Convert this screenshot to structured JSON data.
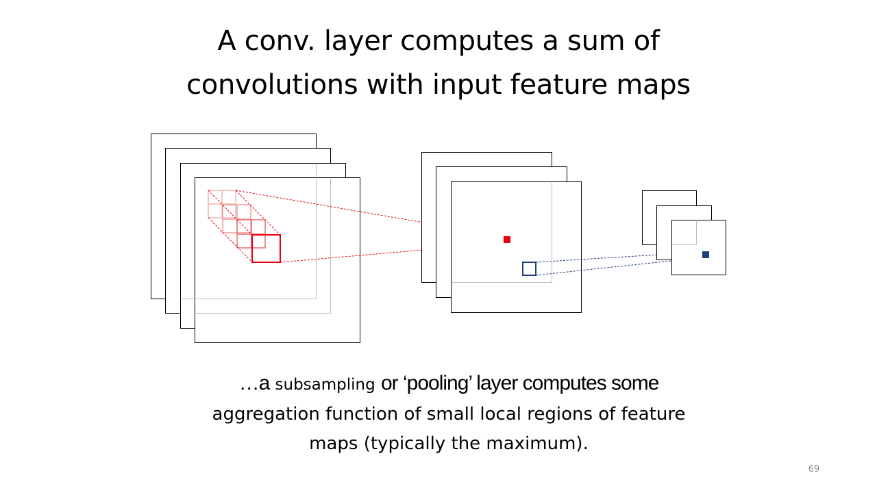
{
  "slide": {
    "title_line1": "A conv. layer computes a sum of",
    "title_line2": "convolutions with input feature maps",
    "caption": {
      "part1": "…a",
      "part2": "subsampling",
      "part3": "or ‘pooling’ layer computes some",
      "line2": "aggregation function of small local regions of feature",
      "line3": "maps (typically the maximum)."
    },
    "page_number": "69"
  },
  "colors": {
    "frame": "#000000",
    "conv_highlight": "#e8000b",
    "conv_faded": "#f4a6a6",
    "pool_highlight": "#1f3f7a"
  },
  "diagram": {
    "input_maps": 4,
    "conv_output_maps": 3,
    "pooled_maps": 3,
    "kernel_layers": 4
  }
}
